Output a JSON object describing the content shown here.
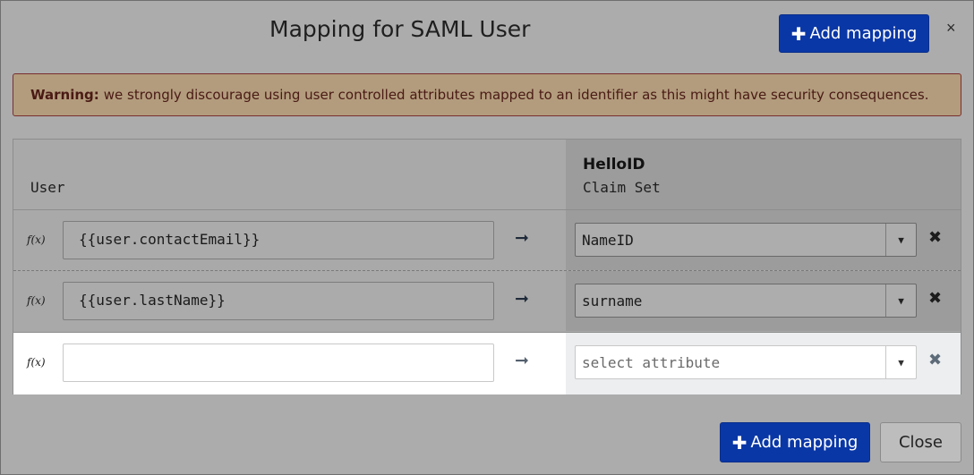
{
  "dialog": {
    "title": "Mapping for SAML User",
    "close_glyph": "×",
    "add_mapping_label": "Add mapping",
    "close_label": "Close",
    "plus_glyph": "✚"
  },
  "warning": {
    "label": "Warning:",
    "text": "we strongly discourage using user controlled attributes mapped to an identifier as this might have security consequences."
  },
  "table": {
    "left_header": "User",
    "right_header_title": "HelloID",
    "right_header_sub": "Claim Set",
    "fx_label": "f(x)",
    "arrow_glyph": "➞",
    "delete_glyph": "✖",
    "caret_glyph": "▼",
    "rows": [
      {
        "expression": "{{user.contactEmail}}",
        "attribute": "NameID"
      },
      {
        "expression": "{{user.lastName}}",
        "attribute": "surname"
      },
      {
        "expression": "",
        "attribute": "",
        "attribute_placeholder": "select attribute"
      }
    ]
  },
  "colors": {
    "primary": "#0a37a6",
    "warning_bg": "#b29c7d",
    "warning_border": "#7a2e2e"
  }
}
